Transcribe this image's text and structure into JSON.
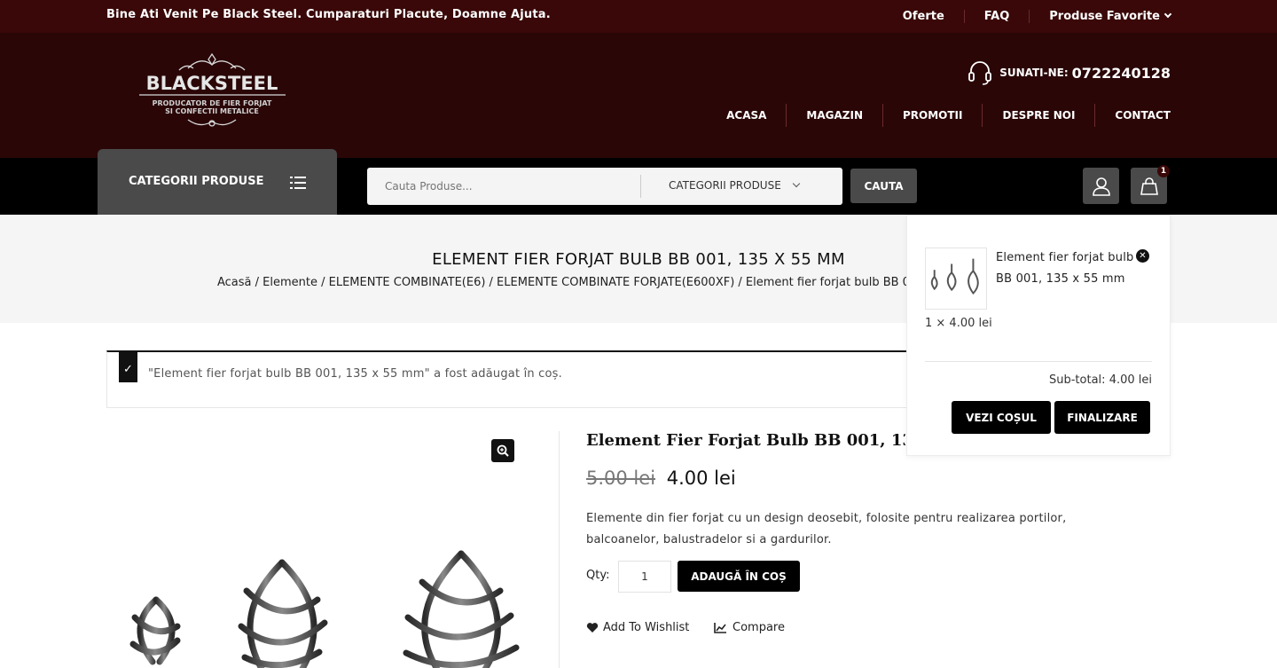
{
  "topbar": {
    "welcome": "Bine Ati Venit Pe Black Steel. Cumparaturi Placute, Doamne Ajuta.",
    "links": [
      "Oferte",
      "FAQ",
      "Produse Favorite"
    ]
  },
  "header": {
    "logo_text": "BLACKSTEEL",
    "logo_sub1": "PRODUCATOR DE FIER FORJAT",
    "logo_sub2": "SI CONFECTII METALICE",
    "phone_label": "SUNATI-NE:",
    "phone_number": "0722240128",
    "nav": [
      "ACASA",
      "MAGAZIN",
      "PROMOTII",
      "DESPRE NOI",
      "CONTACT"
    ]
  },
  "searchbar": {
    "categories_label": "CATEGORII PRODUSE",
    "search_placeholder": "Cauta Produse...",
    "category_select": "CATEGORII PRODUSE",
    "search_button": "CAUTA",
    "cart_count": "1"
  },
  "page": {
    "title": "ELEMENT FIER FORJAT BULB BB 001, 135 X 55 MM",
    "breadcrumb": "Acasă / Elemente / ELEMENTE COMBINATE(E6) / ELEMENTE COMBINATE FORJATE(E600XF) / Element fier forjat bulb BB 001, 135 x 55 mm"
  },
  "notice": {
    "message": "\"Element fier forjat bulb BB 001, 135 x 55 mm\" a fost adăugat în coș."
  },
  "product": {
    "title": "Element Fier Forjat Bulb BB 001, 135 x 55 mm",
    "old_price": "5.00 lei",
    "new_price": "4.00 lei",
    "description": "Elemente din fier forjat cu un design deosebit, folosite pentru realizarea portilor, balcoanelor, balustradelor si a gardurilor.",
    "qty_label": "Qty:",
    "qty_value": "1",
    "add_to_cart": "ADAUGĂ ÎN COȘ",
    "wishlist": "Add To Wishlist",
    "compare": "Compare"
  },
  "minicart": {
    "item_name": "Element fier forjat bulb BB 001, 135 x 55 mm",
    "item_qty": "1 × 4.00 lei",
    "subtotal_label": "Sub-total:",
    "subtotal_value": "4.00 lei",
    "view_cart": "VEZI COȘUL",
    "checkout": "FINALIZARE"
  },
  "colors": {
    "topbar": "#3a0808",
    "header": "#2a0607",
    "strip": "#000000",
    "button_gray": "#4a4a4a"
  }
}
